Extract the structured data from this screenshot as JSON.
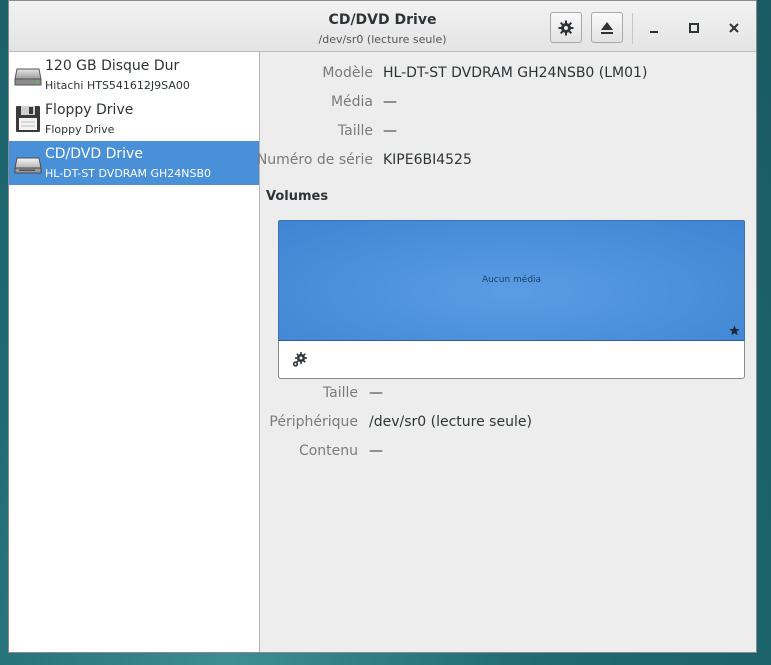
{
  "window": {
    "title": "CD/DVD Drive",
    "subtitle": "/dev/sr0 (lecture seule)"
  },
  "header_buttons": {
    "settings_icon": "gear-icon",
    "eject_icon": "eject-icon",
    "minimize_label": "_",
    "maximize_icon": "maximize-icon",
    "close_label": "✕"
  },
  "devices": [
    {
      "name": "120 GB Disque Dur",
      "desc": "Hitachi HTS541612J9SA00",
      "icon": "hard-disk-icon",
      "selected": false
    },
    {
      "name": "Floppy Drive",
      "desc": "Floppy Drive",
      "icon": "floppy-icon",
      "selected": false
    },
    {
      "name": "CD/DVD Drive",
      "desc": "HL-DT-ST DVDRAM GH24NSB0",
      "icon": "optical-drive-icon",
      "selected": true
    }
  ],
  "drive_props": [
    {
      "label": "Modèle",
      "value": "HL-DT-ST DVDRAM GH24NSB0 (LM01)"
    },
    {
      "label": "Média",
      "value": "—"
    },
    {
      "label": "Taille",
      "value": "—"
    },
    {
      "label": "Numéro de série",
      "value": "KIPE6BI4525"
    }
  ],
  "volumes": {
    "title": "Volumes",
    "empty_label": "Aucun média"
  },
  "volume_props": [
    {
      "label": "Taille",
      "value": "—"
    },
    {
      "label": "Périphérique",
      "value": "/dev/sr0 (lecture seule)"
    },
    {
      "label": "Contenu",
      "value": "—"
    }
  ],
  "colors": {
    "selection": "#4a90d9",
    "volume_fill": "#3f84d2"
  }
}
